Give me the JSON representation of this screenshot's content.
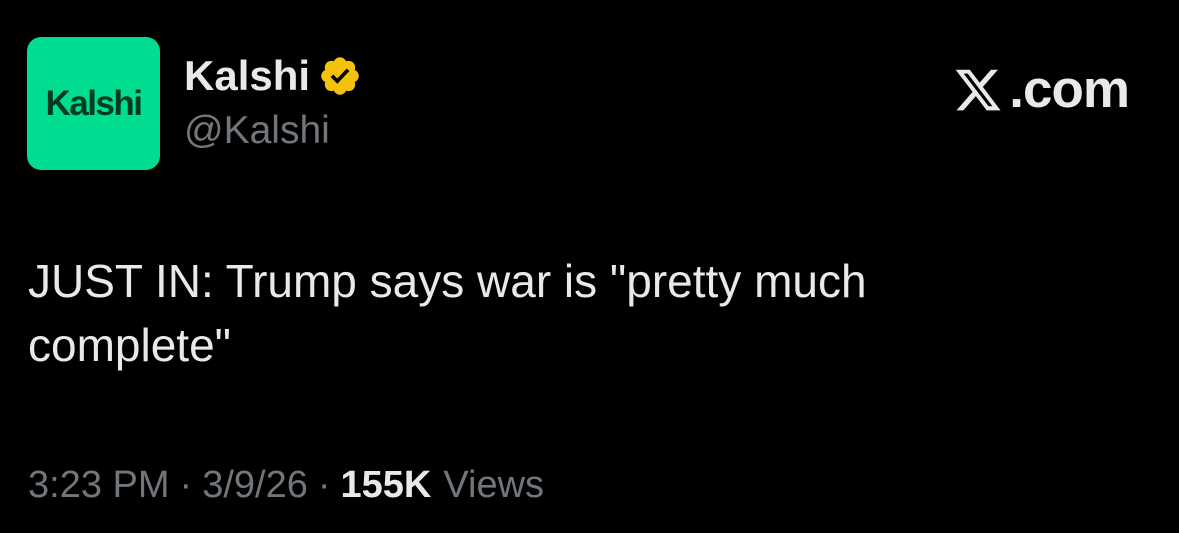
{
  "account": {
    "avatar_text": "Kalshi",
    "display_name": "Kalshi",
    "handle": "@Kalshi",
    "verified_icon": "verified-badge-icon",
    "avatar_color": "#00dd90",
    "verified_color": "#f4c20d"
  },
  "brand": {
    "domain": ".com",
    "logo_icon": "x-logo-icon"
  },
  "tweet": {
    "text": "JUST IN: Trump says war is \"pretty much\ncomplete\"",
    "time": "3:23 PM",
    "date": "3/9/26",
    "views_count": "155K",
    "views_label": "Views",
    "separator": "·"
  },
  "colors": {
    "background": "#000000",
    "primary_text": "#e7e9ea",
    "secondary_text": "#71767b"
  }
}
